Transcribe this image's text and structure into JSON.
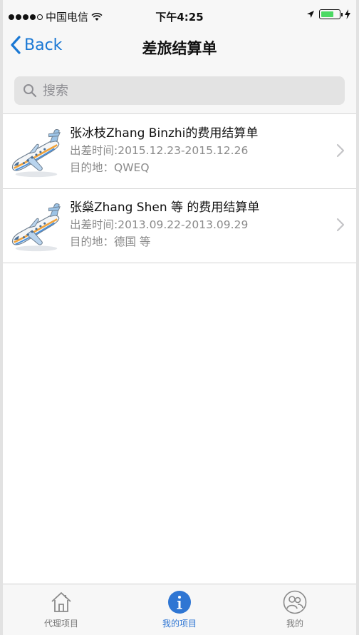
{
  "status_bar": {
    "carrier": "中国电信",
    "time": "下午4:25"
  },
  "nav": {
    "back_label": "Back",
    "title": "差旅结算单"
  },
  "search": {
    "placeholder": "搜索"
  },
  "settlements": [
    {
      "title": "张冰枝Zhang Binzhi的费用结算单",
      "dates": "出差时间:2015.12.23-2015.12.26",
      "destination": "目的地：QWEQ"
    },
    {
      "title": "张燊Zhang Shen 等 的费用结算单",
      "dates": "出差时间:2013.09.22-2013.09.29",
      "destination": "目的地：德国 等"
    }
  ],
  "tabs": [
    {
      "label": "代理项目",
      "icon": "home-icon",
      "active": false
    },
    {
      "label": "我的项目",
      "icon": "info-icon",
      "active": true
    },
    {
      "label": "我的",
      "icon": "users-icon",
      "active": false
    }
  ],
  "colors": {
    "accent": "#2f76d3",
    "back_blue": "#1a78d4",
    "battery_green": "#4cd964"
  }
}
